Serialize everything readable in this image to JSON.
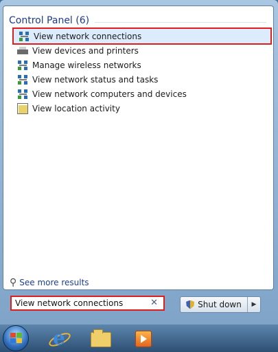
{
  "control_panel": {
    "header": "Control Panel (6)",
    "results": [
      {
        "label": "View network connections",
        "icon": "network-icon",
        "selected": true
      },
      {
        "label": "View devices and printers",
        "icon": "devices-printers-icon",
        "selected": false
      },
      {
        "label": "Manage wireless networks",
        "icon": "network-icon",
        "selected": false
      },
      {
        "label": "View network status and tasks",
        "icon": "network-icon",
        "selected": false
      },
      {
        "label": "View network computers and devices",
        "icon": "network-icon",
        "selected": false
      },
      {
        "label": "View location activity",
        "icon": "location-activity-icon",
        "selected": false
      }
    ]
  },
  "see_more": {
    "label": "See more results",
    "icon": "magnifier-icon"
  },
  "search": {
    "value": "View network connections",
    "clear_icon": "clear-icon"
  },
  "shutdown": {
    "label": "Shut down",
    "icon": "shield-icon",
    "arrow_icon": "right-arrow-icon"
  },
  "taskbar": {
    "items": [
      {
        "name": "start-orb",
        "icon": "windows-start-icon"
      },
      {
        "name": "internet-explorer",
        "icon": "internet-explorer-icon"
      },
      {
        "name": "windows-explorer",
        "icon": "folder-icon"
      },
      {
        "name": "media-player",
        "icon": "media-player-icon"
      }
    ]
  },
  "colors": {
    "highlight_border": "#e01d1d",
    "header_text": "#1e3b8a",
    "link_text": "#1c3f8f"
  }
}
